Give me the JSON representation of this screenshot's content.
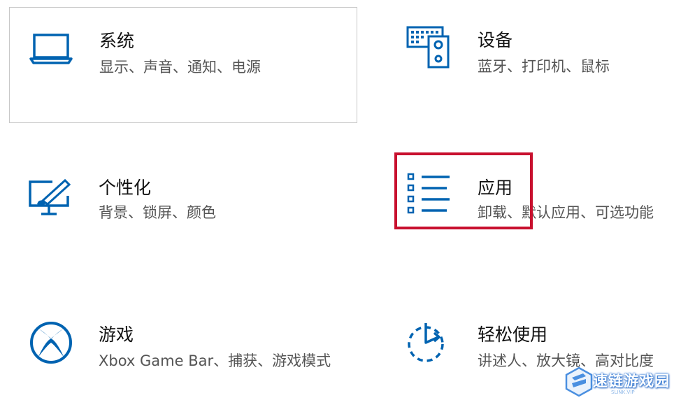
{
  "tiles": [
    {
      "title": "系统",
      "desc": "显示、声音、通知、电源",
      "icon": "laptop-icon"
    },
    {
      "title": "设备",
      "desc": "蓝牙、打印机、鼠标",
      "icon": "keyboard-speaker-icon"
    },
    {
      "title": "个性化",
      "desc": "背景、锁屏、颜色",
      "icon": "paint-display-icon"
    },
    {
      "title": "应用",
      "desc": "卸载、默认应用、可选功能",
      "icon": "apps-list-icon"
    },
    {
      "title": "游戏",
      "desc": "Xbox Game Bar、捕获、游戏模式",
      "icon": "xbox-icon"
    },
    {
      "title": "轻松使用",
      "desc": "讲述人、放大镜、高对比度",
      "icon": "ease-of-access-icon"
    }
  ],
  "watermark": {
    "text": "速链游戏园",
    "sub": "SLINK.VIP"
  },
  "colors": {
    "accent": "#0063b1",
    "highlight": "#c8102e"
  }
}
